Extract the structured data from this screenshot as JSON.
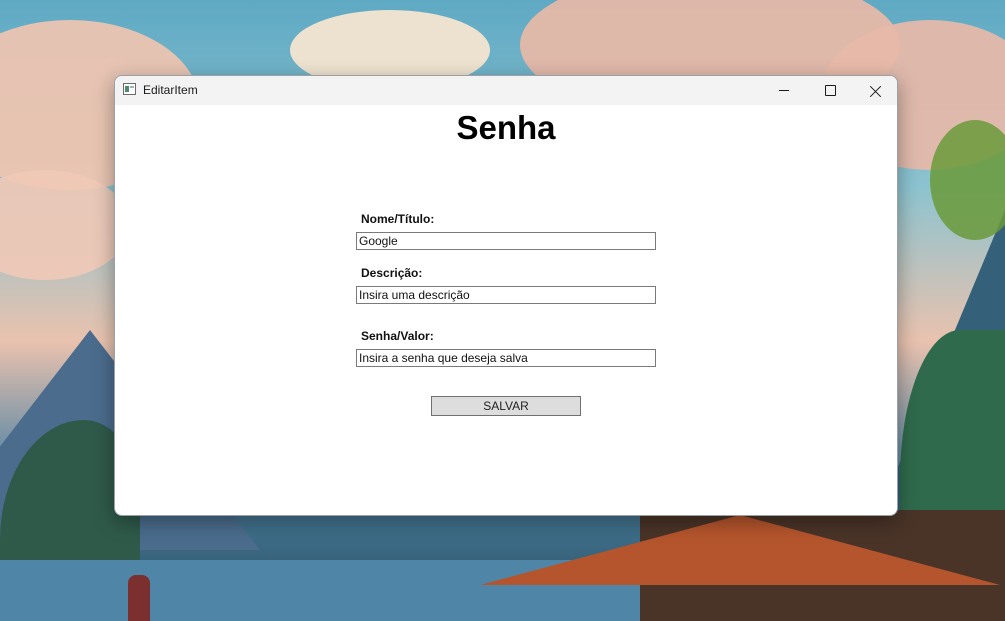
{
  "window": {
    "title": "EditarItem",
    "icon": "app-window-icon",
    "controls": {
      "minimize_icon": "minimize-icon",
      "maximize_icon": "maximize-icon",
      "close_icon": "close-icon"
    }
  },
  "form": {
    "heading": "Senha",
    "name_label": "Nome/Título:",
    "name_value": "Google",
    "description_label": "Descrição:",
    "description_placeholder": "Insira uma descrição",
    "password_label": "Senha/Valor:",
    "password_placeholder": "Insira a senha que deseja salva",
    "save_label": "SALVAR"
  }
}
